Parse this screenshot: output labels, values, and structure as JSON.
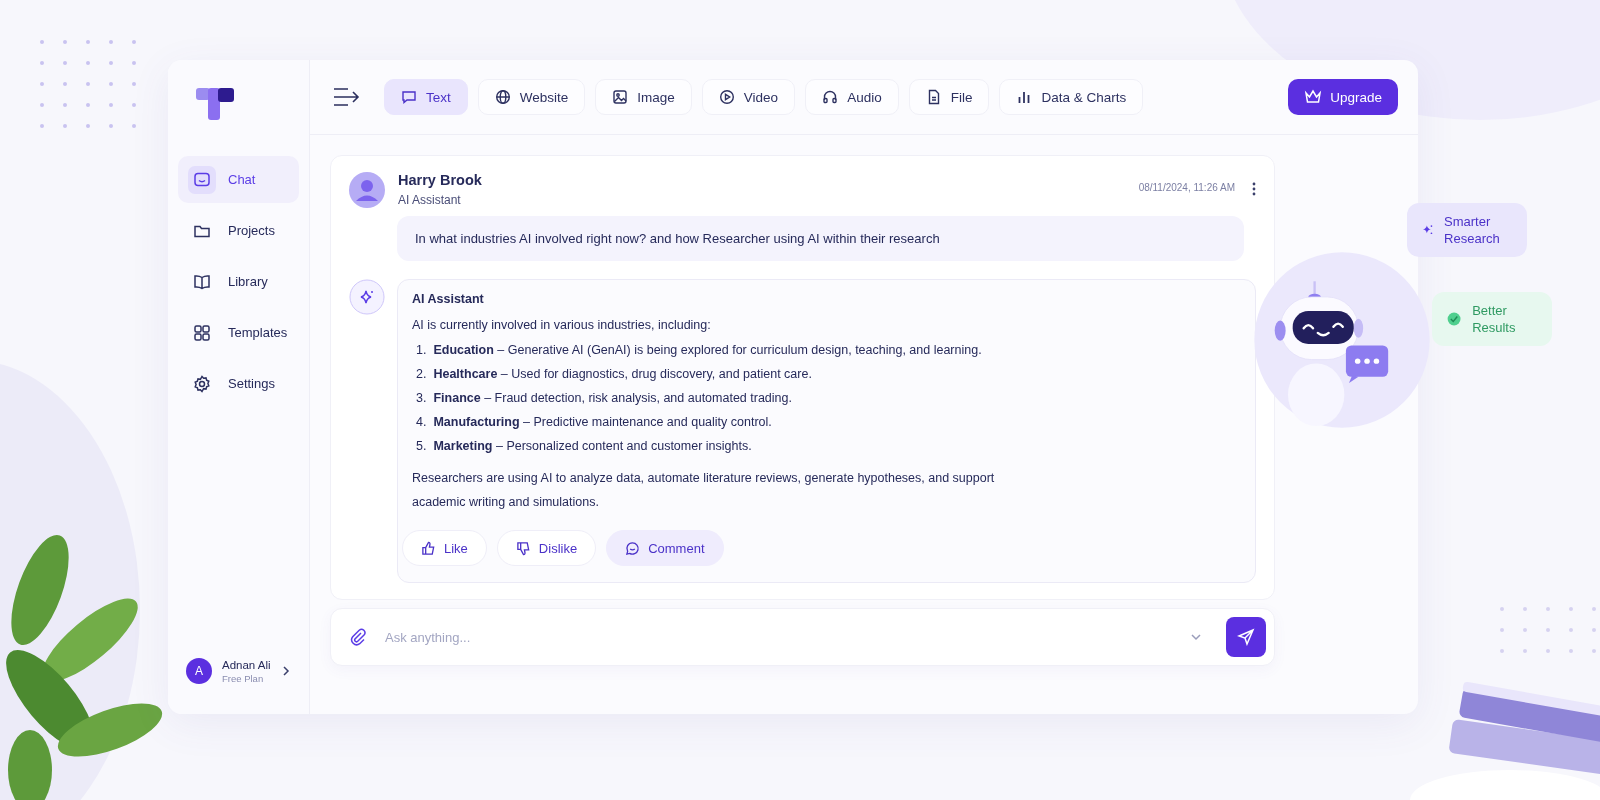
{
  "sidebar": {
    "items": [
      {
        "label": "Chat",
        "selected": true
      },
      {
        "label": "Projects",
        "selected": false
      },
      {
        "label": "Library",
        "selected": false
      },
      {
        "label": "Templates",
        "selected": false
      },
      {
        "label": "Settings",
        "selected": false
      }
    ],
    "user": {
      "initial": "A",
      "name": "Adnan Ali",
      "plan": "Free Plan"
    }
  },
  "toolbar": {
    "tabs": [
      {
        "label": "Text",
        "selected": true
      },
      {
        "label": "Website",
        "selected": false
      },
      {
        "label": "Image",
        "selected": false
      },
      {
        "label": "Video",
        "selected": false
      },
      {
        "label": "Audio",
        "selected": false
      },
      {
        "label": "File",
        "selected": false
      },
      {
        "label": "Data & Charts",
        "selected": false
      }
    ],
    "upgrade_button": "Upgrade"
  },
  "chat": {
    "user_message": {
      "name": "Harry Brook",
      "role": "AI Assistant",
      "time": "08/11/2024, 11:26 AM",
      "text": "In what industries AI involved right now? and how Researcher using AI within their research"
    },
    "assistant_message": {
      "title": "AI Assistant",
      "intro": "AI is currently involved in various industries, including:",
      "items": [
        {
          "number": "1.",
          "text": "**Education** – Generative AI (GenAI) is being explored for curriculum design, teaching, and learning."
        },
        {
          "number": "2.",
          "text": "**Healthcare** – Used for diagnostics, drug discovery, and patient care."
        },
        {
          "number": "3.",
          "text": "**Finance** – Fraud detection, risk analysis, and automated trading."
        },
        {
          "number": "4.",
          "text": "**Manufacturing** – Predictive maintenance and quality control."
        },
        {
          "number": "5.",
          "text": "**Marketing** – Personalized content and customer insights."
        }
      ],
      "closing": "Researchers are using AI to analyze data, automate literature reviews, generate hypotheses, and support academic writing and simulations.",
      "actions": [
        {
          "label": "Like",
          "selected": false
        },
        {
          "label": "Dislike",
          "selected": false
        },
        {
          "label": "Comment",
          "selected": true
        }
      ]
    }
  },
  "composer": {
    "placeholder": "Ask anything..."
  },
  "badges": [
    {
      "kind": "sparkle",
      "text": "Smarter Research"
    },
    {
      "kind": "check",
      "text": "Better Results"
    }
  ]
}
